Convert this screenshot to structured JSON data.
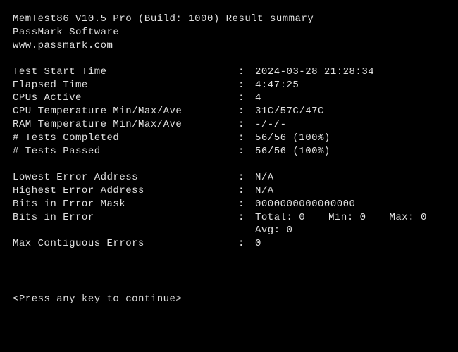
{
  "header": {
    "title": "MemTest86 V10.5 Pro (Build: 1000) Result summary",
    "vendor": "PassMark Software",
    "url": "www.passmark.com"
  },
  "section1": {
    "test_start_time": {
      "label": "Test Start Time",
      "value": "2024-03-28 21:28:34"
    },
    "elapsed_time": {
      "label": "Elapsed Time",
      "value": "4:47:25"
    },
    "cpus_active": {
      "label": "CPUs Active",
      "value": "4"
    },
    "cpu_temp": {
      "label": "CPU Temperature Min/Max/Ave",
      "value": "31C/57C/47C"
    },
    "ram_temp": {
      "label": "RAM Temperature Min/Max/Ave",
      "value": "-/-/-"
    },
    "tests_completed": {
      "label": "# Tests Completed",
      "value": "56/56 (100%)"
    },
    "tests_passed": {
      "label": "# Tests Passed",
      "value": "56/56 (100%)"
    }
  },
  "section2": {
    "lowest_err_addr": {
      "label": "Lowest Error Address",
      "value": "N/A"
    },
    "highest_err_addr": {
      "label": "Highest Error Address",
      "value": "N/A"
    },
    "bits_err_mask": {
      "label": "Bits in Error Mask",
      "value": "0000000000000000"
    },
    "bits_in_error": {
      "label": "Bits in Error",
      "total": "Total: 0",
      "min": "Min: 0",
      "max": "Max: 0",
      "avg": "Avg: 0"
    },
    "max_contiguous": {
      "label": "Max Contiguous Errors",
      "value": "0"
    }
  },
  "prompt": "<Press any key to continue>"
}
